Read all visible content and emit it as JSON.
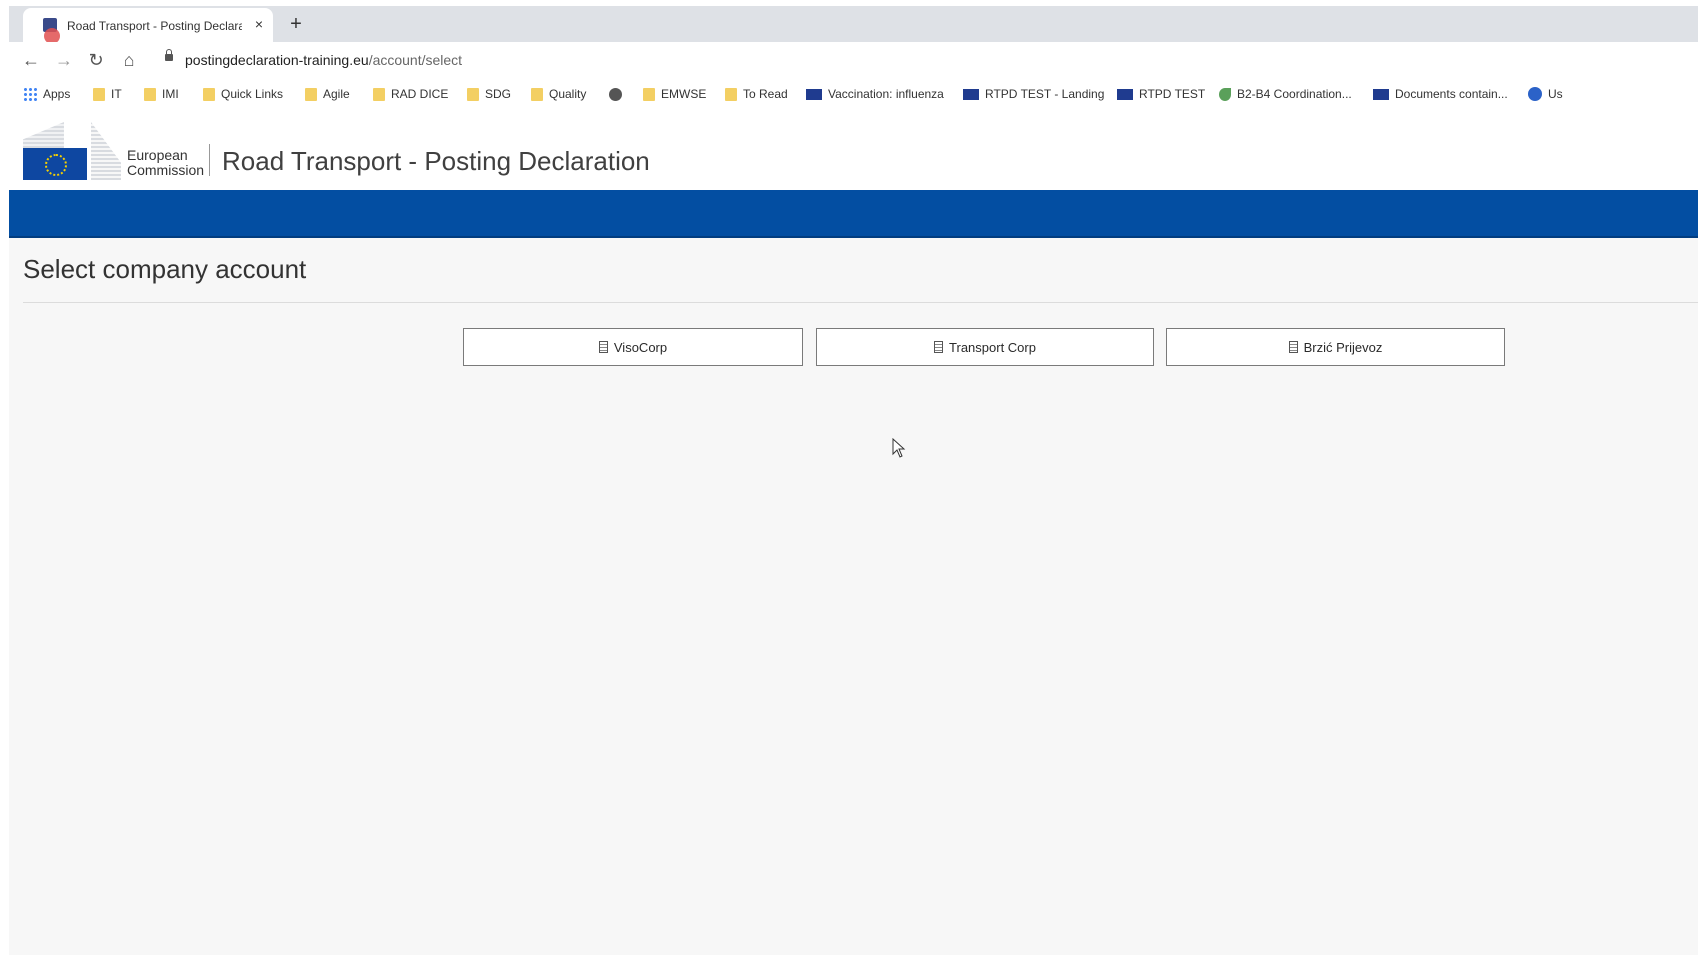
{
  "browser": {
    "tab_title": "Road Transport - Posting Declara",
    "tab_close": "×",
    "new_tab": "+",
    "url_host": "postingdeclaration-training.eu",
    "url_path": "/account/select",
    "bookmarks": [
      {
        "label": "Apps",
        "icon": "apps-grid-icon"
      },
      {
        "label": "IT",
        "icon": "folder-icon"
      },
      {
        "label": "IMI",
        "icon": "folder-icon"
      },
      {
        "label": "Quick Links",
        "icon": "folder-icon"
      },
      {
        "label": "Agile",
        "icon": "folder-icon"
      },
      {
        "label": "RAD DICE",
        "icon": "folder-icon"
      },
      {
        "label": "SDG",
        "icon": "folder-icon"
      },
      {
        "label": "Quality",
        "icon": "folder-icon"
      },
      {
        "label": "",
        "icon": "globe-icon"
      },
      {
        "label": "EMWSE",
        "icon": "folder-icon"
      },
      {
        "label": "To Read",
        "icon": "folder-icon"
      },
      {
        "label": "Vaccination: influenza",
        "icon": "eu-flag-icon"
      },
      {
        "label": "RTPD TEST - Landing",
        "icon": "eu-flag-icon"
      },
      {
        "label": "RTPD TEST",
        "icon": "eu-flag-icon"
      },
      {
        "label": "B2-B4 Coordination...",
        "icon": "leaf-icon"
      },
      {
        "label": "Documents contain...",
        "icon": "eu-flag-icon"
      },
      {
        "label": "Us",
        "icon": "blue-circle-icon"
      }
    ]
  },
  "header": {
    "logo_line1": "European",
    "logo_line2": "Commission",
    "site_title": "Road Transport - Posting Declaration"
  },
  "page": {
    "title": "Select company account",
    "accounts": [
      {
        "label": "VisoCorp",
        "icon": "building-icon"
      },
      {
        "label": "Transport Corp",
        "icon": "building-icon"
      },
      {
        "label": "Brzić Prijevoz",
        "icon": "building-icon"
      }
    ]
  },
  "colors": {
    "brand_band": "#034ea2",
    "eu_flag": "#0e47a1",
    "eu_stars": "#f7d100"
  }
}
